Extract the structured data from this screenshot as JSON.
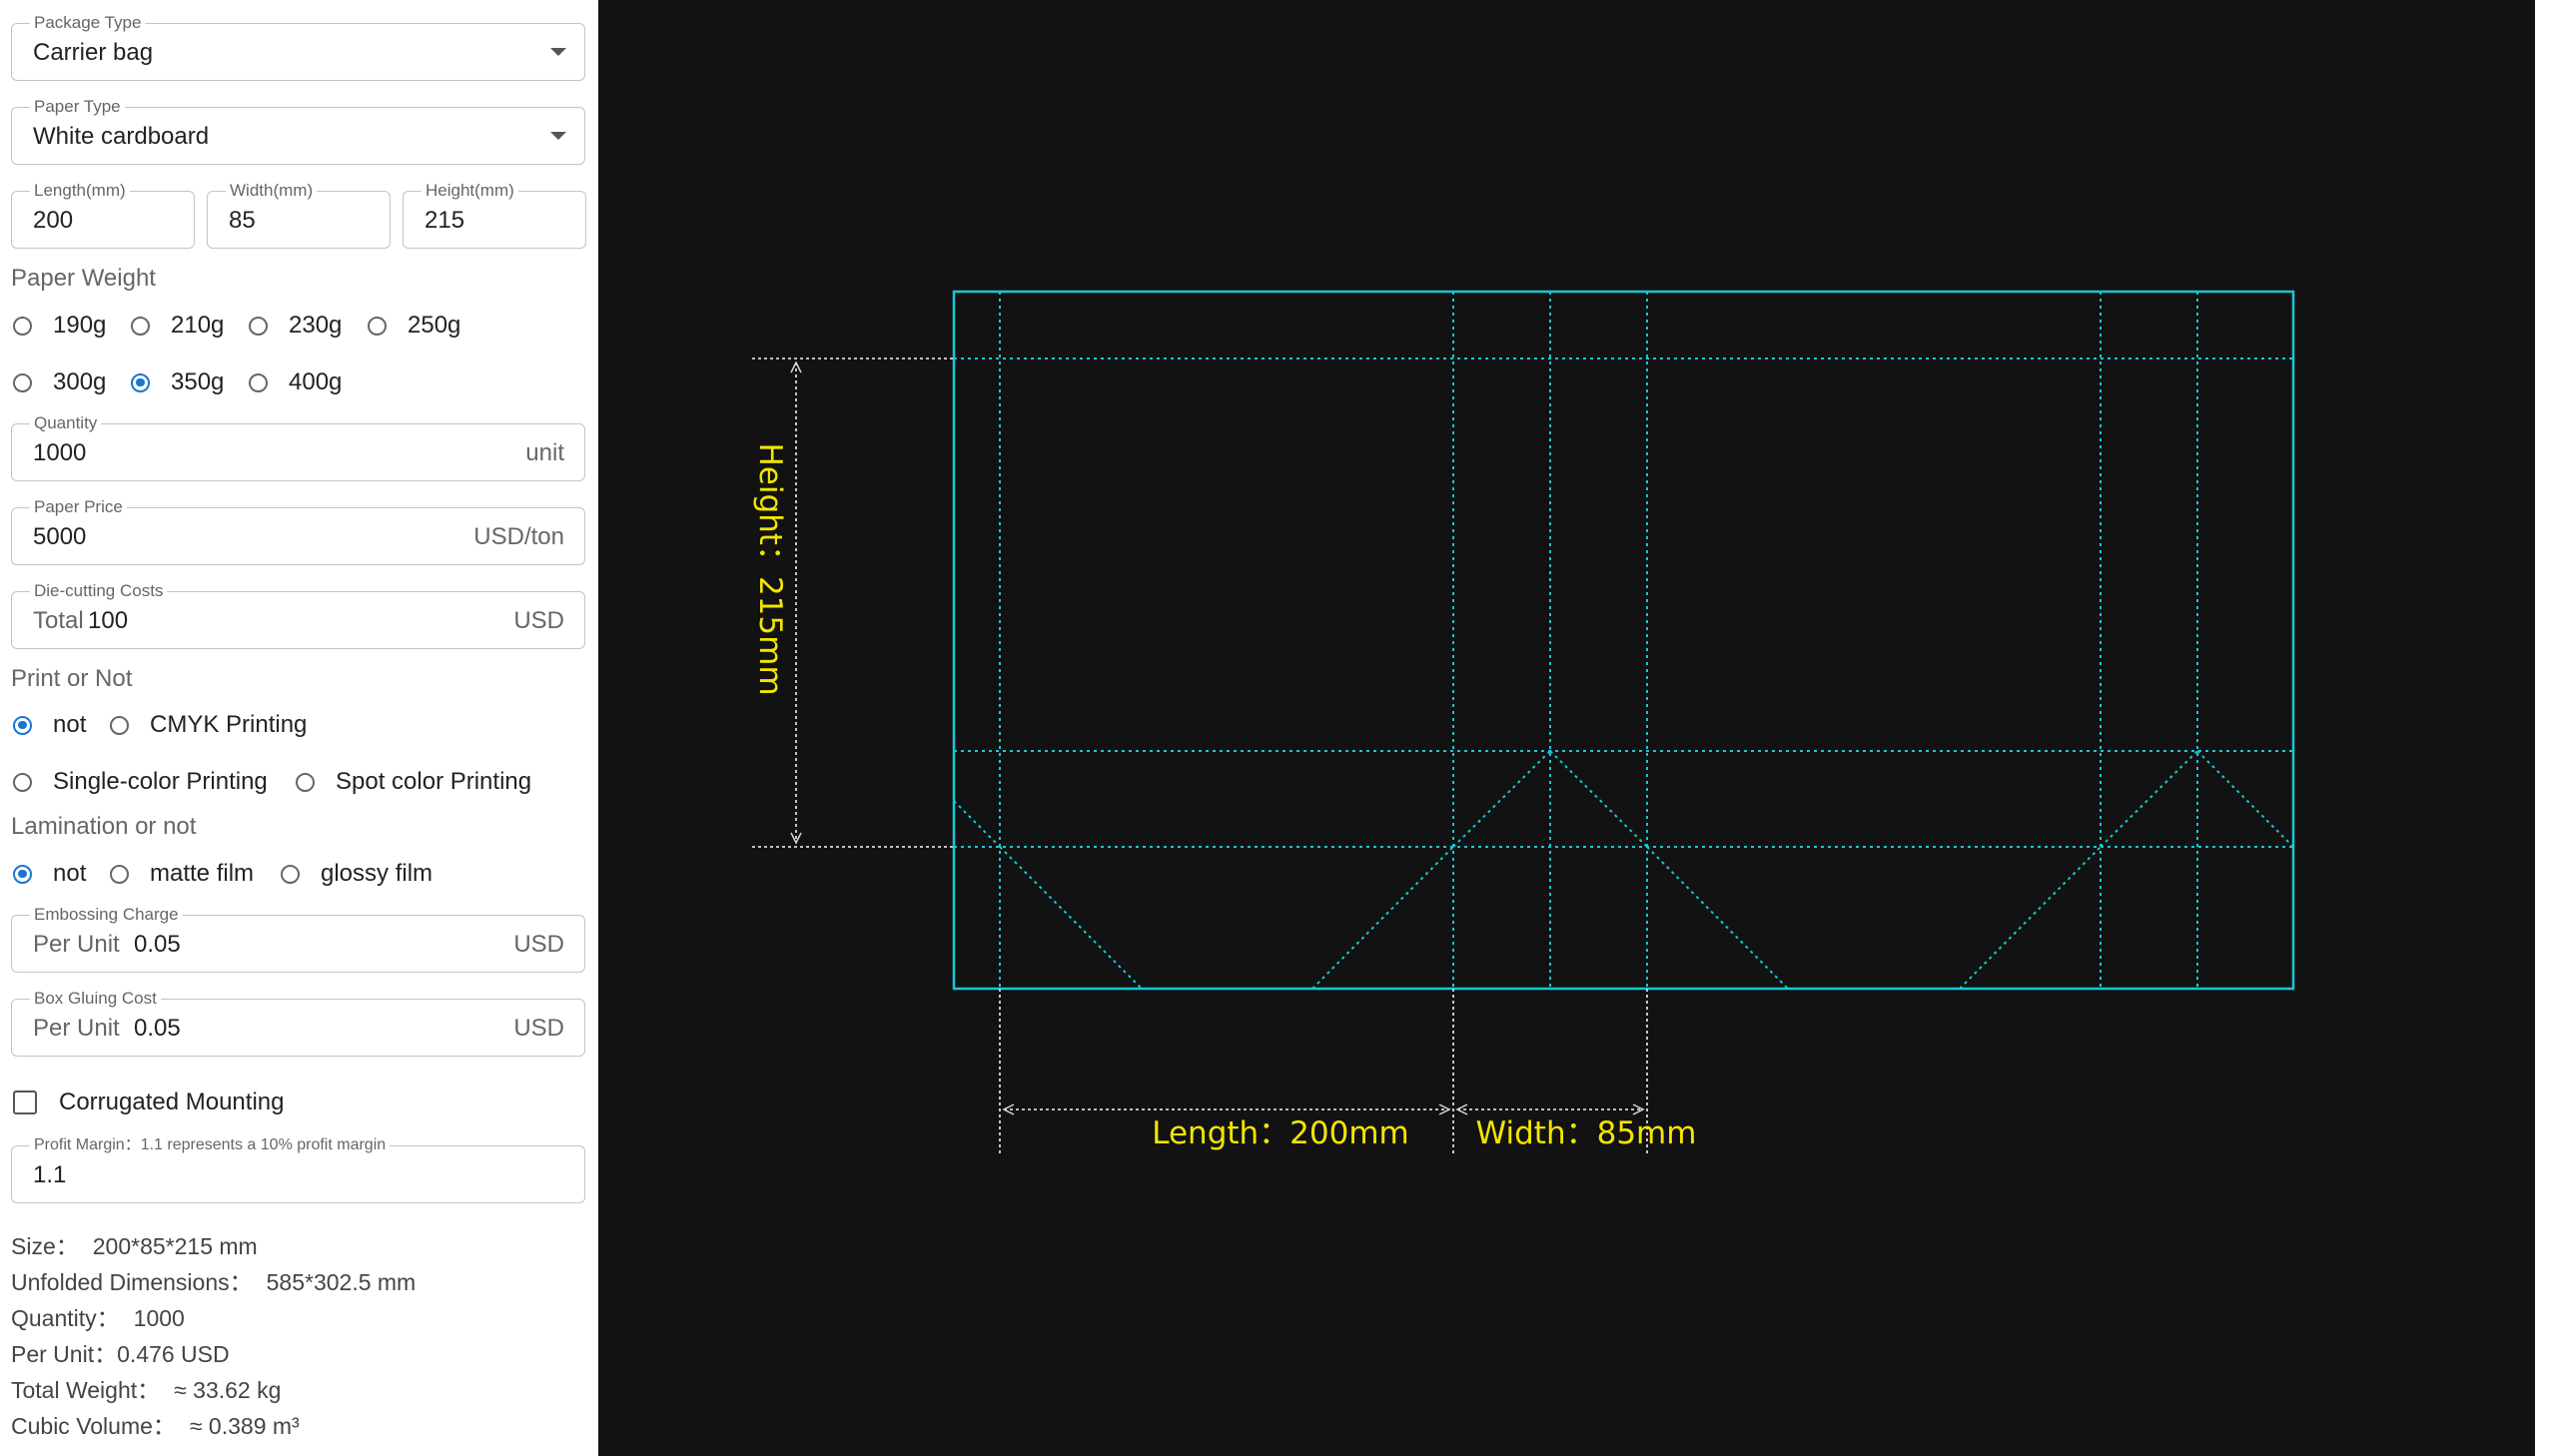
{
  "form": {
    "package_type": {
      "label": "Package Type",
      "value": "Carrier bag"
    },
    "paper_type": {
      "label": "Paper Type",
      "value": "White cardboard"
    },
    "length": {
      "label": "Length(mm)",
      "value": "200"
    },
    "width": {
      "label": "Width(mm)",
      "value": "85"
    },
    "height": {
      "label": "Height(mm)",
      "value": "215"
    },
    "paper_weight": {
      "label": "Paper Weight",
      "options": [
        "190g",
        "210g",
        "230g",
        "250g",
        "300g",
        "350g",
        "400g"
      ],
      "selected": "350g"
    },
    "quantity": {
      "label": "Quantity",
      "value": "1000",
      "suffix": "unit"
    },
    "paper_price": {
      "label": "Paper Price",
      "value": "5000",
      "suffix": "USD/ton"
    },
    "die_cutting": {
      "label": "Die-cutting Costs",
      "prefix": "Total",
      "value": "100",
      "suffix": "USD"
    },
    "print": {
      "label": "Print or Not",
      "options": [
        "not",
        "CMYK Printing",
        "Single-color Printing",
        "Spot color Printing"
      ],
      "selected": "not"
    },
    "lamination": {
      "label": "Lamination or not",
      "options": [
        "not",
        "matte film",
        "glossy film"
      ],
      "selected": "not"
    },
    "embossing": {
      "label": "Embossing Charge",
      "prefix": "Per Unit",
      "value": "0.05",
      "suffix": "USD"
    },
    "gluing": {
      "label": "Box Gluing Cost",
      "prefix": "Per Unit",
      "value": "0.05",
      "suffix": "USD"
    },
    "corrugated": {
      "label": "Corrugated Mounting",
      "checked": false
    },
    "profit_margin": {
      "label": "Profit Margin：1.1 represents a 10% profit margin",
      "value": "1.1"
    }
  },
  "summary": {
    "size": {
      "label": "Size：",
      "value": "200*85*215 mm"
    },
    "unfolded": {
      "label": "Unfolded Dimensions：",
      "value": "585*302.5 mm"
    },
    "quantity": {
      "label": "Quantity：",
      "value": "1000"
    },
    "per_unit": {
      "label": "Per Unit：",
      "value": "0.476 USD"
    },
    "total_weight": {
      "label": "Total Weight：",
      "value": "≈ 33.62 kg"
    },
    "cubic_volume": {
      "label": "Cubic Volume：",
      "value": "≈ 0.389 m³"
    }
  },
  "drawing": {
    "height_label": "Height：215mm",
    "length_label": "Length：200mm",
    "width_label": "Width：85mm",
    "colors": {
      "outline": "#18c8d4",
      "dimension_text": "#f2e600",
      "dimension_line": "#d8d8d8",
      "background": "#121212"
    }
  }
}
